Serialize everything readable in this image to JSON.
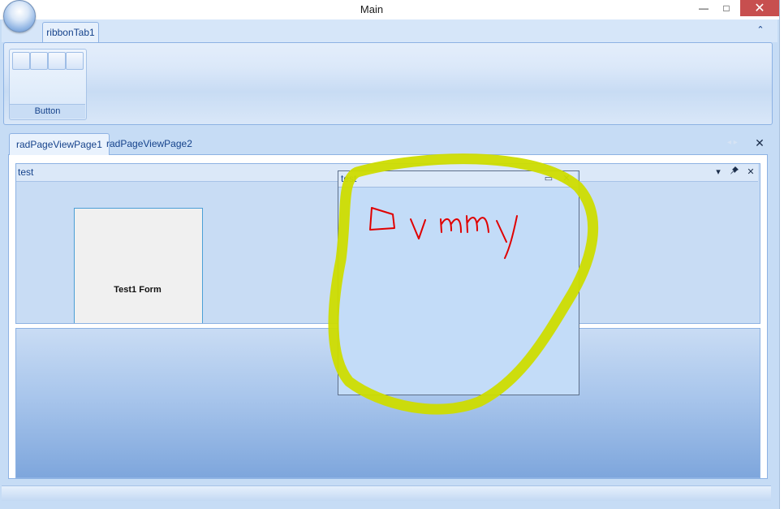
{
  "window": {
    "title": "Main",
    "minimize_glyph": "—",
    "maximize_glyph": "□",
    "close_glyph": "✕"
  },
  "ribbon": {
    "tab_label": "ribbonTab1",
    "collapse_glyph": "⌃",
    "group_label": "Button"
  },
  "page_view": {
    "tabs": [
      {
        "label": "radPageViewPage1",
        "active": true
      },
      {
        "label": "radPageViewPage2",
        "active": false
      }
    ],
    "arrows_glyph": "◂ ▸",
    "close_glyph": "✕"
  },
  "dock_window": {
    "title": "test",
    "menu_glyph": "▾",
    "pin_glyph": "📌",
    "close_glyph": "✕",
    "form_label": "Test1 Form"
  },
  "floating_window": {
    "title": "test",
    "maximize_glyph": "▭",
    "close_glyph": "✕"
  },
  "colors": {
    "highlight_stroke": "#cddc00",
    "scribble_stroke": "#e00000",
    "accent": "#15428b"
  },
  "annotation": {
    "handwritten_text": "Dummy"
  }
}
